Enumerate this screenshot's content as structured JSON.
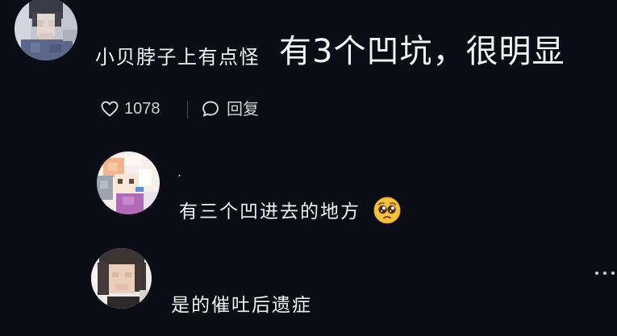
{
  "comment": {
    "text": "小贝脖子上有点怪",
    "caption": "有3个凹坑，很明显",
    "likes": "1078",
    "reply_label": "回复",
    "avatar_icon": "blurred-user-avatar"
  },
  "replies": [
    {
      "username": ".",
      "text": "有三个凹进去的地方",
      "emoji": "pleading-face-emoji",
      "avatar_icon": "blurred-user-avatar"
    },
    {
      "text": "是的催吐后遗症",
      "avatar_icon": "blurred-user-avatar"
    }
  ],
  "icons": {
    "like": "heart-outline-icon",
    "reply": "speech-bubble-icon",
    "more": "more-options-icon"
  },
  "colors": {
    "background": "#0b0c15",
    "text": "#f2f2f4",
    "secondary_text": "#d2d3d9",
    "emoji_yellow": "#f6c23b"
  }
}
